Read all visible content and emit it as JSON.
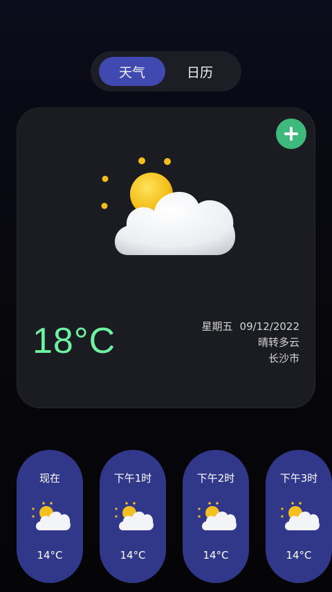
{
  "tabs": [
    {
      "label": "天气",
      "active": true
    },
    {
      "label": "日历",
      "active": false
    }
  ],
  "card": {
    "add_icon": "plus-icon",
    "weather_icon": "sun-behind-cloud-icon",
    "temperature": "18°C",
    "weekday": "星期五",
    "date": "09/12/2022",
    "condition": "晴转多云",
    "city": "长沙市"
  },
  "hourly": [
    {
      "label": "现在",
      "temp": "14°C",
      "icon": "sun-behind-cloud-icon"
    },
    {
      "label": "下午1时",
      "temp": "14°C",
      "icon": "sun-behind-cloud-icon"
    },
    {
      "label": "下午2时",
      "temp": "14°C",
      "icon": "sun-behind-cloud-icon"
    },
    {
      "label": "下午3时",
      "temp": "14°C",
      "icon": "sun-behind-cloud-icon"
    }
  ],
  "colors": {
    "accent": "#4049b0",
    "temperature": "#6ef2a2",
    "add_button": "#40b97c",
    "pill": "#313889"
  }
}
